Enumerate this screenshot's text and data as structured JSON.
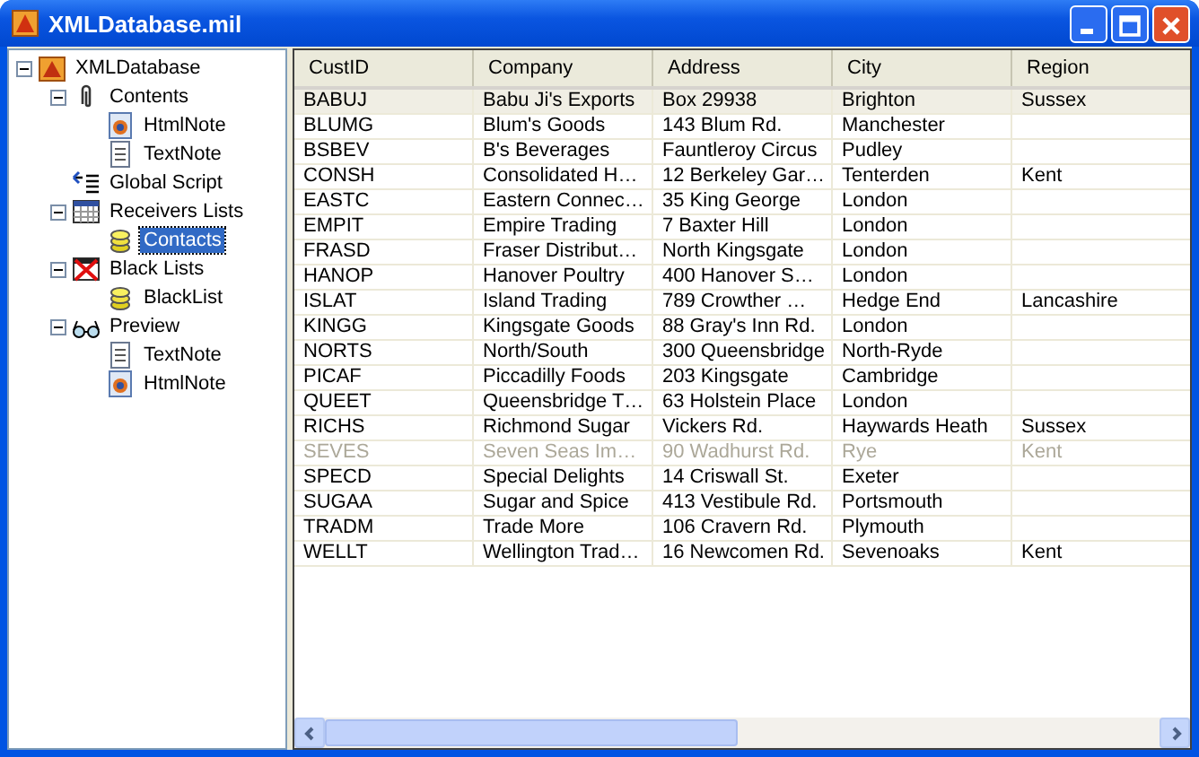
{
  "window": {
    "title": "XMLDatabase.mil"
  },
  "tree": [
    {
      "label": "XMLDatabase",
      "kind": "database",
      "expanded": true,
      "selected": false,
      "children": [
        {
          "label": "Contents",
          "kind": "clip",
          "expanded": true,
          "selected": false,
          "children": [
            {
              "label": "HtmlNote",
              "kind": "html",
              "selected": false
            },
            {
              "label": "TextNote",
              "kind": "text",
              "selected": false
            }
          ]
        },
        {
          "label": "Global Script",
          "kind": "script",
          "selected": false
        },
        {
          "label": "Receivers Lists",
          "kind": "table",
          "expanded": true,
          "selected": false,
          "children": [
            {
              "label": "Contacts",
              "kind": "coins",
              "selected": true
            }
          ]
        },
        {
          "label": "Black Lists",
          "kind": "blacklist",
          "expanded": true,
          "selected": false,
          "children": [
            {
              "label": "BlackList",
              "kind": "coins",
              "selected": false
            }
          ]
        },
        {
          "label": "Preview",
          "kind": "glasses",
          "expanded": true,
          "selected": false,
          "children": [
            {
              "label": "TextNote",
              "kind": "text",
              "selected": false
            },
            {
              "label": "HtmlNote",
              "kind": "html",
              "selected": false
            }
          ]
        }
      ]
    }
  ],
  "table": {
    "columns": [
      "CustID",
      "Company",
      "Address",
      "City",
      "Region"
    ],
    "rows": [
      {
        "cells": [
          "BABUJ",
          "Babu Ji's Exports",
          "Box 29938",
          "Brighton",
          "Sussex"
        ],
        "selected": true,
        "disabled": false
      },
      {
        "cells": [
          "BLUMG",
          "Blum's Goods",
          "143 Blum Rd.",
          "Manchester",
          ""
        ],
        "selected": false,
        "disabled": false
      },
      {
        "cells": [
          "BSBEV",
          "B's Beverages",
          "Fauntleroy Circus",
          "Pudley",
          ""
        ],
        "selected": false,
        "disabled": false
      },
      {
        "cells": [
          "CONSH",
          "Consolidated H…",
          "12 Berkeley Gar…",
          "Tenterden",
          "Kent"
        ],
        "selected": false,
        "disabled": false
      },
      {
        "cells": [
          "EASTC",
          "Eastern Connec…",
          "35 King George",
          "London",
          ""
        ],
        "selected": false,
        "disabled": false
      },
      {
        "cells": [
          "EMPIT",
          "Empire Trading",
          "7 Baxter Hill",
          "London",
          ""
        ],
        "selected": false,
        "disabled": false
      },
      {
        "cells": [
          "FRASD",
          "Fraser Distribut…",
          "North Kingsgate",
          "London",
          ""
        ],
        "selected": false,
        "disabled": false
      },
      {
        "cells": [
          "HANOP",
          "Hanover Poultry",
          "400 Hanover S…",
          "London",
          ""
        ],
        "selected": false,
        "disabled": false
      },
      {
        "cells": [
          "ISLAT",
          "Island Trading",
          "789 Crowther …",
          "Hedge End",
          "Lancashire"
        ],
        "selected": false,
        "disabled": false
      },
      {
        "cells": [
          "KINGG",
          "Kingsgate Goods",
          "88 Gray's Inn Rd.",
          "London",
          ""
        ],
        "selected": false,
        "disabled": false
      },
      {
        "cells": [
          "NORTS",
          "North/South",
          "300 Queensbridge",
          "North-Ryde",
          ""
        ],
        "selected": false,
        "disabled": false
      },
      {
        "cells": [
          "PICAF",
          "Piccadilly Foods",
          "203 Kingsgate",
          "Cambridge",
          ""
        ],
        "selected": false,
        "disabled": false
      },
      {
        "cells": [
          "QUEET",
          "Queensbridge T…",
          "63 Holstein Place",
          "London",
          ""
        ],
        "selected": false,
        "disabled": false
      },
      {
        "cells": [
          "RICHS",
          "Richmond Sugar",
          "Vickers Rd.",
          "Haywards Heath",
          "Sussex"
        ],
        "selected": false,
        "disabled": false
      },
      {
        "cells": [
          "SEVES",
          "Seven Seas Im…",
          "90 Wadhurst Rd.",
          "Rye",
          "Kent"
        ],
        "selected": false,
        "disabled": true
      },
      {
        "cells": [
          "SPECD",
          "Special Delights",
          "14 Criswall St.",
          "Exeter",
          ""
        ],
        "selected": false,
        "disabled": false
      },
      {
        "cells": [
          "SUGAA",
          "Sugar and Spice",
          "413 Vestibule Rd.",
          "Portsmouth",
          ""
        ],
        "selected": false,
        "disabled": false
      },
      {
        "cells": [
          "TRADM",
          "Trade More",
          "106 Cravern Rd.",
          "Plymouth",
          ""
        ],
        "selected": false,
        "disabled": false
      },
      {
        "cells": [
          "WELLT",
          "Wellington Trad…",
          "16 Newcomen Rd.",
          "Sevenoaks",
          "Kent"
        ],
        "selected": false,
        "disabled": false
      }
    ]
  }
}
